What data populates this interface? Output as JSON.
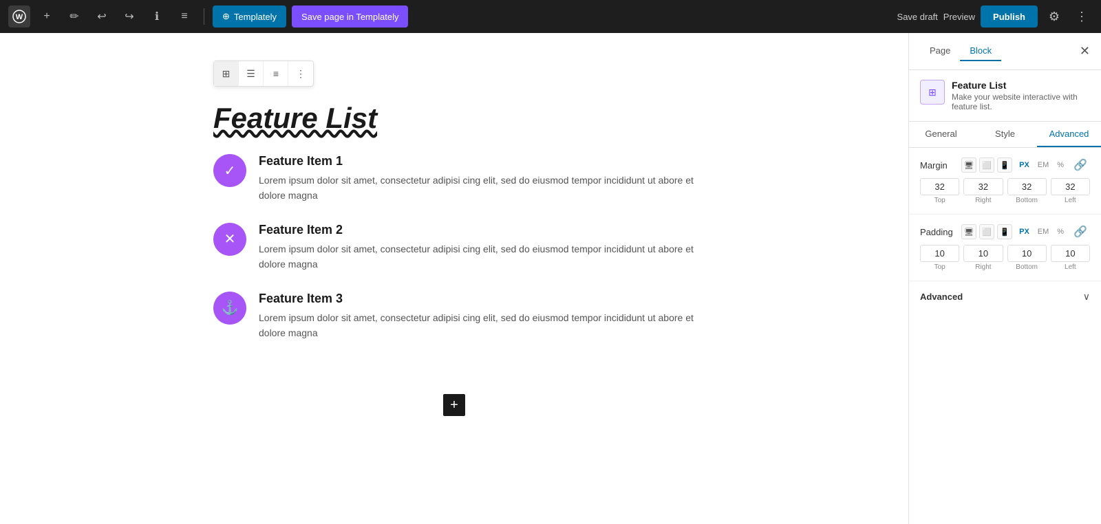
{
  "toolbar": {
    "wp_logo": "W",
    "add_label": "+",
    "pencil_icon": "✏",
    "undo_icon": "↩",
    "redo_icon": "↪",
    "info_icon": "ℹ",
    "list_icon": "≡",
    "templately_label": "Templately",
    "save_page_label": "Save page in Templately",
    "save_draft_label": "Save draft",
    "preview_label": "Preview",
    "publish_label": "Publish",
    "settings_icon": "⚙",
    "more_icon": "⋮"
  },
  "sidebar": {
    "page_tab": "Page",
    "block_tab": "Block",
    "close_icon": "✕",
    "block_info": {
      "icon": "⊞",
      "title": "Feature List",
      "desc": "Make your website interactive with feature list."
    },
    "panel_tabs": [
      "General",
      "Style",
      "Advanced"
    ],
    "active_panel": "Advanced",
    "margin": {
      "label": "Margin",
      "unit_px": "PX",
      "unit_em": "EM",
      "unit_pct": "%",
      "active_unit": "PX",
      "top": "32",
      "right": "32",
      "bottom": "32",
      "left": "32",
      "top_label": "Top",
      "right_label": "Right",
      "bottom_label": "Bottom",
      "left_label": "Left"
    },
    "padding": {
      "label": "Padding",
      "unit_px": "PX",
      "unit_em": "EM",
      "unit_pct": "%",
      "active_unit": "PX",
      "top": "10",
      "right": "10",
      "bottom": "10",
      "left": "10",
      "top_label": "Top",
      "right_label": "Right",
      "bottom_label": "Bottom",
      "left_label": "Left"
    },
    "advanced_section": {
      "label": "Advanced",
      "chevron": "∨"
    }
  },
  "editor": {
    "feature_list_title": "Feature List",
    "block_toolbar_icons": [
      "⊞",
      "☰",
      "⊟",
      "⋮"
    ],
    "features": [
      {
        "title": "Feature Item 1",
        "desc": "Lorem ipsum dolor sit amet, consectetur adipisi cing elit, sed do eiusmod tempor incididunt ut abore et dolore magna",
        "icon": "✓",
        "icon_type": "check"
      },
      {
        "title": "Feature Item 2",
        "desc": "Lorem ipsum dolor sit amet, consectetur adipisi cing elit, sed do eiusmod tempor incididunt ut abore et dolore magna",
        "icon": "✕",
        "icon_type": "x"
      },
      {
        "title": "Feature Item 3",
        "desc": "Lorem ipsum dolor sit amet, consectetur adipisi cing elit, sed do eiusmod tempor incididunt ut abore et dolore magna",
        "icon": "⚓",
        "icon_type": "anchor"
      }
    ],
    "add_btn": "+"
  }
}
